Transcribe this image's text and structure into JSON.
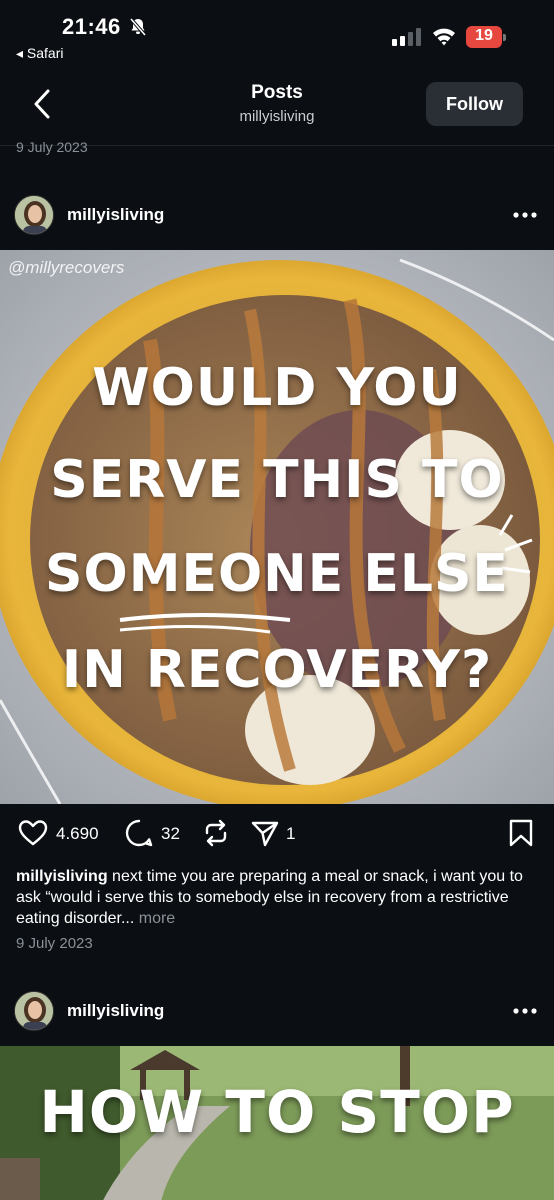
{
  "status_bar": {
    "time": "21:46",
    "back_app": "◂ Safari",
    "battery": "19",
    "battery_color": "#e6473f"
  },
  "header": {
    "title": "Posts",
    "subtitle": "millyisliving",
    "follow_label": "Follow"
  },
  "previous_post_date": "9 July 2023",
  "posts": [
    {
      "username": "millyisliving",
      "watermark": "@millyrecovers",
      "overlay_lines": [
        "WOULD YOU",
        "SERVE THIS TO",
        "SOMEONE ELSE",
        "IN RECOVERY?"
      ],
      "likes": "4.690",
      "comments": "32",
      "shares": "1",
      "caption_user": "millyisliving",
      "caption_text": " next time you are preparing a meal or snack, i want you to ask “would i serve this to somebody else in recovery from a restrictive eating disorder...",
      "caption_more": " more",
      "date": "9 July 2023"
    },
    {
      "username": "millyisliving",
      "overlay_lines": [
        "HOW TO STOP"
      ]
    }
  ],
  "icons": [
    "back-chevron-icon",
    "more-dots-icon",
    "heart-icon",
    "comment-icon",
    "repost-icon",
    "share-icon",
    "bookmark-icon"
  ]
}
